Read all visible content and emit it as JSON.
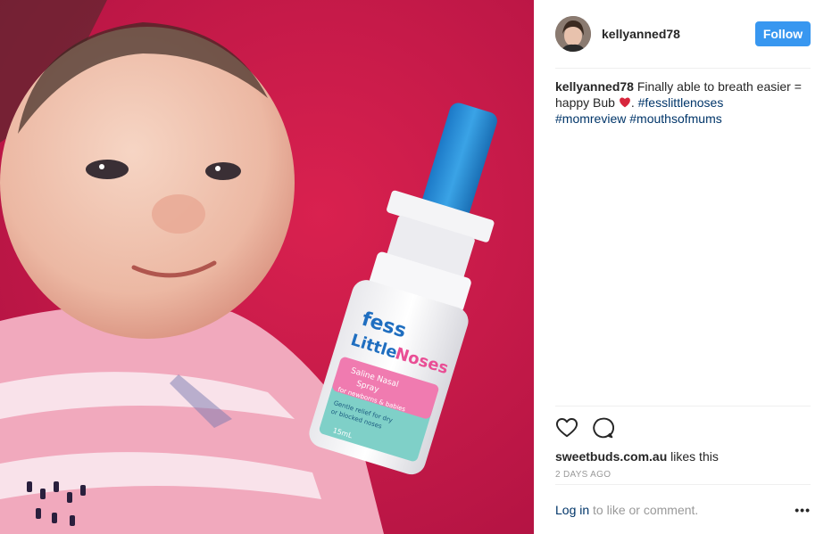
{
  "post": {
    "author": "kellyanned78",
    "follow_label": "Follow",
    "caption": {
      "user": "kellyanned78",
      "text_1": " Finally able to breath easier = happy Bub ",
      "emoji": "heart-emoji",
      "text_2": ". ",
      "hashtags": [
        "#fesslittlenoses",
        "#momreview",
        "#mouthsofmums"
      ]
    },
    "likes": {
      "liker": "sweetbuds.com.au",
      "suffix": " likes this"
    },
    "age": "2 DAYS AGO",
    "footer": {
      "login": "Log in",
      "rest": " to like or comment.",
      "more": "•••"
    }
  },
  "photo": {
    "description_icons": [
      "baby-photo",
      "nasal-spray-bottle"
    ],
    "bottle_label": {
      "brand_1": "fess",
      "brand_2": "Little",
      "brand_3": "Noses",
      "line_1": "Saline Nasal",
      "line_2": "Spray",
      "line_3": "for newborns & babies",
      "line_4": "Gentle relief for dry",
      "line_5": "or blocked noses",
      "volume": "15mL"
    }
  },
  "colors": {
    "accent": "#3897f0",
    "link": "#003569",
    "background": "#d21a4e"
  }
}
